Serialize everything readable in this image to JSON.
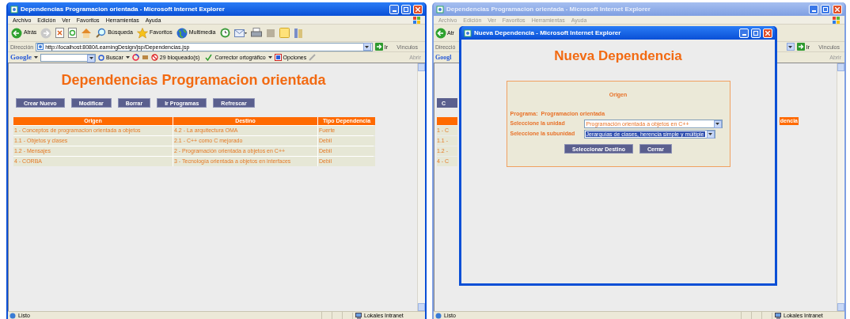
{
  "main_window": {
    "title": "Dependencias Programacion orientada - Microsoft Internet Explorer",
    "active": true,
    "menu": [
      "Archivo",
      "Edición",
      "Ver",
      "Favoritos",
      "Herramientas",
      "Ayuda"
    ],
    "toolbar": [
      {
        "kind": "back",
        "label": "Atrás"
      },
      {
        "kind": "forward"
      },
      {
        "kind": "stop"
      },
      {
        "kind": "refresh"
      },
      {
        "kind": "home"
      },
      {
        "kind": "search",
        "label": "Búsqueda"
      },
      {
        "kind": "favorites",
        "label": "Favoritos"
      },
      {
        "kind": "media",
        "label": "Multimedia"
      },
      {
        "kind": "history"
      },
      {
        "kind": "mail"
      },
      {
        "kind": "print"
      },
      {
        "kind": "edit"
      },
      {
        "kind": "notes"
      },
      {
        "kind": "research"
      }
    ],
    "address_label": "Dirección",
    "url": "http://localhost:8080/LearningDesign/jsp/Dependencias.jsp",
    "go": "Ir",
    "links": "Vínculos",
    "google": {
      "logo": "Google",
      "search": "Buscar",
      "blocked": "29 bloqueado(s)",
      "spell": "Corrector ortográfico",
      "options": "Opciones",
      "open": "Abrir"
    },
    "page": {
      "heading": "Dependencias Programacion orientada",
      "buttons": [
        "Crear Nuevo",
        "Modificar",
        "Borrar",
        "Ir Programas",
        "Refrescar"
      ],
      "table": {
        "columns": [
          "Origen",
          "Destino",
          "Tipo Dependencia"
        ],
        "rows": [
          [
            "1 - Conceptos de programacion orientada a objetos",
            "4.2 - La arquitectura OMA",
            "Fuerte"
          ],
          [
            "1.1 - Objetos y clases",
            "2.1 - C++ como C mejorado",
            "Debil"
          ],
          [
            "1.2 - Mensajes",
            "2 - Programación orientada a objetos en C++",
            "Debil"
          ],
          [
            "4 - CORBA",
            "3 - Tecnología orientada a objetos en interfaces",
            "Debil"
          ]
        ]
      }
    },
    "status": "Listo",
    "zone": "Lokales Intranet"
  },
  "background_window": {
    "title": "Dependencias Programacion orientada - Microsoft Internet Explorer",
    "active": false,
    "menu": [
      "Archivo",
      "Edición",
      "Ver",
      "Favoritos",
      "Herramientas",
      "Ayuda"
    ],
    "toolbar_fragment": "Atr",
    "address_label": "Direcció",
    "go": "Ir",
    "links": "Vínculos",
    "google_logo": "Googl",
    "open": "Abrir",
    "button_fragment": "C",
    "column_fragment": "dencia",
    "row_fragments": [
      "1 - C",
      "1.1 -",
      "1.2 -",
      "4 - C"
    ],
    "status": "Listo",
    "zone": "Lokales Intranet"
  },
  "dialog": {
    "title": "Nueva Dependencia - Microsoft Internet Explorer",
    "active": true,
    "heading": "Nueva Dependencia",
    "box_title": "Origen",
    "program_label": "Programa:",
    "program": "Programacion orientada",
    "fields": [
      {
        "label": "Seleccione la unidad",
        "value": "Programación orientada a objetos en C++",
        "selected": false
      },
      {
        "label": "Seleccione la subunidad",
        "value": "Jerarquías de clases, herencia simple y múltiple",
        "selected": true
      }
    ],
    "buttons": [
      "Seleccionar Destino",
      "Cerrar"
    ]
  }
}
